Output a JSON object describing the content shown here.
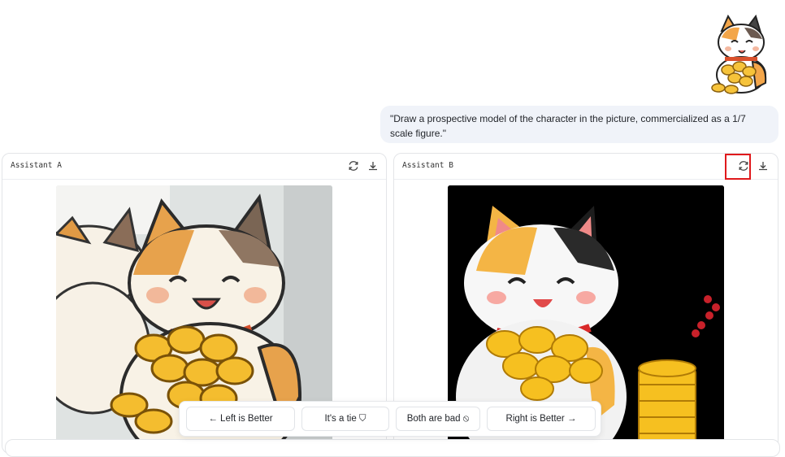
{
  "prompt": {
    "text": "\"Draw a prospective model of the character in the picture, commercialized as a 1/7 scale figure.\""
  },
  "panels": {
    "a": {
      "title": "Assistant A"
    },
    "b": {
      "title": "Assistant B"
    }
  },
  "vote": {
    "left": "← Left is Better",
    "tie": "It's a tie ⛉",
    "bad": "Both are bad ⦸",
    "right": "Right is Better →"
  },
  "icons": {
    "regenerate": "refresh-icon",
    "download": "download-icon"
  },
  "colors": {
    "highlight": "#e0191c",
    "bubble": "#f0f3f9"
  }
}
